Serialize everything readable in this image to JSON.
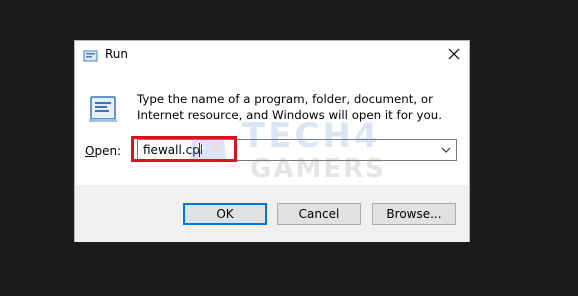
{
  "window": {
    "title": "Run"
  },
  "description": "Type the name of a program, folder, document, or Internet resource, and Windows will open it for you.",
  "open": {
    "label_prefix": "O",
    "label_rest": "pen:",
    "value": "fiewall.cpl"
  },
  "buttons": {
    "ok": "OK",
    "cancel": "Cancel",
    "browse": "Browse..."
  },
  "watermark": {
    "line1": "TECH4",
    "line2": "GAMERS"
  },
  "colors": {
    "highlight": "#d4161c",
    "ok_border": "#0078d7",
    "background": "#1c1c1c"
  },
  "icons": {
    "title": "run-app-icon",
    "close": "close-icon",
    "dropdown": "chevron-down-icon",
    "run": "run-dialog-icon"
  }
}
